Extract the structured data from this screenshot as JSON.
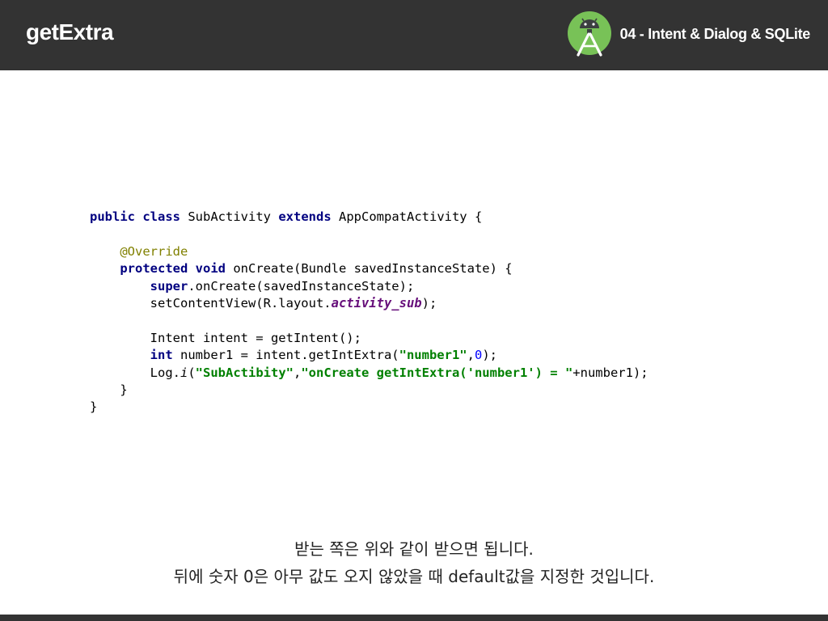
{
  "header": {
    "title": "getExtra",
    "subtitle": "04 - Intent & Dialog & SQLite",
    "logo_icon": "android-studio-logo-icon",
    "colors": {
      "bar": "#333333",
      "logo_green": "#78c257"
    }
  },
  "code": {
    "line1": {
      "k1": "public",
      "k2": "class",
      "t1": " SubActivity ",
      "k3": "extends",
      "t2": " AppCompatActivity {"
    },
    "line3": {
      "anno": "@Override"
    },
    "line4": {
      "k1": "protected",
      "k2": "void",
      "t1": " onCreate(Bundle savedInstanceState) {"
    },
    "line5": {
      "k1": "super",
      "t1": ".onCreate(savedInstanceState);"
    },
    "line6": {
      "t1": "setContentView(R.layout.",
      "field": "activity_sub",
      "t2": ");"
    },
    "line8": {
      "t1": "Intent intent = getIntent();"
    },
    "line9": {
      "k1": "int",
      "t1": " number1 = intent.getIntExtra(",
      "s1": "\"number1\"",
      "t2": ",",
      "n1": "0",
      "t3": ");"
    },
    "line10": {
      "t1": "Log.",
      "m": "i",
      "t2": "(",
      "s1": "\"SubActibity\"",
      "t3": ",",
      "s2": "\"onCreate getIntExtra('number1') = \"",
      "t4": "+number1);"
    },
    "line11": {
      "t1": "}"
    },
    "line12": {
      "t1": "}"
    }
  },
  "caption": {
    "line1": "받는 쪽은 위와 같이 받으면 됩니다.",
    "line2": "뒤에 숫자 0은 아무 값도 오지 않았을 때 default값을 지정한 것입니다."
  }
}
